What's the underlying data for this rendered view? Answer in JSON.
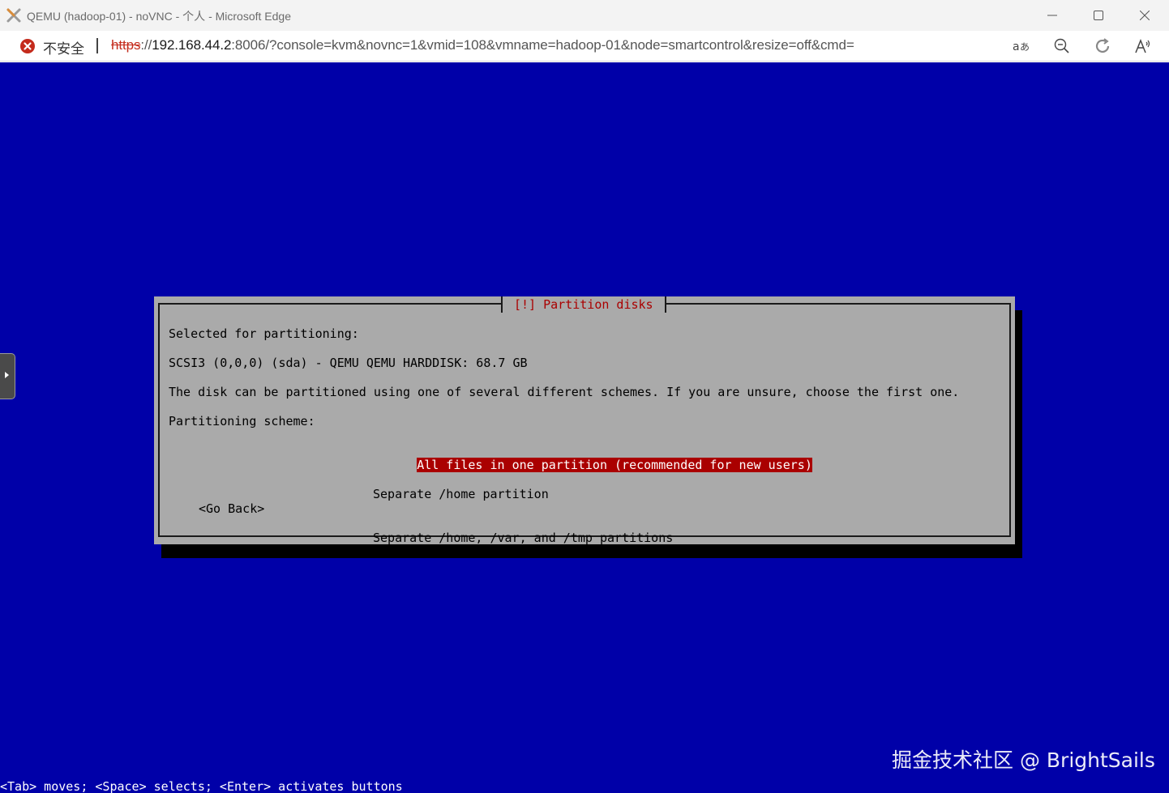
{
  "browser": {
    "window_title": "QEMU (hadoop-01) - noVNC - 个人 - Microsoft Edge",
    "security_label": "不安全",
    "url_scheme": "https",
    "url_rest_1": "://",
    "url_host": "192.168.44.2",
    "url_rest_2": ":8006/?console=kvm&novnc=1&vmid=108&vmname=hadoop-01&node=smartcontrol&resize=off&cmd=",
    "icons": [
      "app-icon",
      "not-secure-icon",
      "translate-icon",
      "zoom-out-icon",
      "refresh-icon",
      "read-aloud-icon"
    ]
  },
  "installer": {
    "title": "[!] Partition disks",
    "selected_label": "Selected for partitioning:",
    "disk": "SCSI3 (0,0,0) (sda) - QEMU QEMU HARDDISK: 68.7 GB",
    "description": "The disk can be partitioned using one of several different schemes. If you are unsure, choose the first one.",
    "scheme_label": "Partitioning scheme:",
    "schemes": [
      "All files in one partition (recommended for new users)",
      "Separate /home partition",
      "Separate /home, /var, and /tmp partitions"
    ],
    "selected_index": 0,
    "go_back": "<Go Back>",
    "hint": "<Tab> moves; <Space> selects; <Enter> activates buttons"
  },
  "watermark": "掘金技术社区 @ BrightSails",
  "colors": {
    "console_bg": "#0000a8",
    "dialog_bg": "#aaaaaa",
    "accent_red": "#aa0000"
  }
}
